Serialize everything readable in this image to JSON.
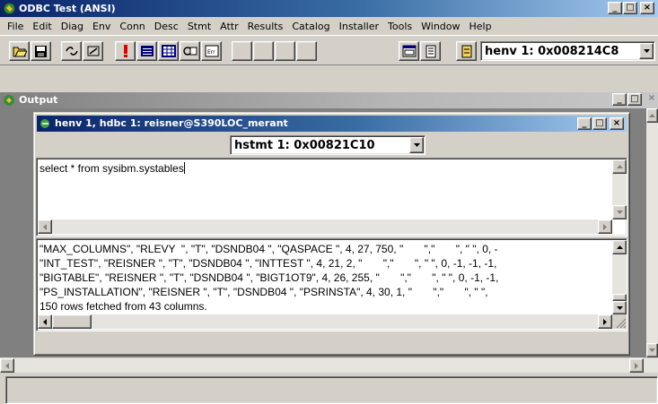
{
  "app": {
    "title": "ODBC Test (ANSI)"
  },
  "menu": [
    "File",
    "Edit",
    "Diag",
    "Env",
    "Conn",
    "Desc",
    "Stmt",
    "Attr",
    "Results",
    "Catalog",
    "Installer",
    "Tools",
    "Window",
    "Help"
  ],
  "toolbar": {
    "henv_selected": "henv 1: 0x008214C8",
    "icons": [
      "open-folder-icon",
      "save-disk-icon",
      "connect-icon",
      "disconnect-icon",
      "error-icon",
      "result-text-icon",
      "grid-icon",
      "data-link-icon",
      "error-list-icon",
      "blank-button",
      "blank-button",
      "blank-button",
      "blank-button",
      "window-icon",
      "document-icon",
      "rules-icon"
    ]
  },
  "output_window": {
    "title": "Output"
  },
  "connection_window": {
    "title": "henv 1, hdbc 1: reisner@S390LOC_merant",
    "hstmt_selected": "hstmt 1: 0x00821C10",
    "sql": "select * from sysibm.systables",
    "results": [
      "\"MAX_COLUMNS\", \"RLEVY  \", \"T\", \"DSNDB04 \", \"QASPACE \", 4, 27, 750, \"       \",\"       \", \" \", 0, -",
      "\"INT_TEST\", \"REISNER \", \"T\", \"DSNDB04 \", \"INTTEST \", 4, 21, 2, \"       \",\"       \", \" \", 0, -1, -1, -1,",
      "\"BIGTABLE\", \"REISNER \", \"T\", \"DSNDB04 \", \"BIGT1OT9\", 4, 26, 255, \"       \",\"       \", \" \", 0, -1, -1,",
      "\"PS_INSTALLATION\", \"REISNER \", \"T\", \"DSNDB04 \", \"PSRINSTA\", 4, 30, 1, \"       \",\"       \", \" \",",
      "150 rows fetched from 43 columns."
    ]
  },
  "colors": {
    "active_title": "#0a246a",
    "inactive_title": "#808080",
    "face": "#d4d0c8"
  }
}
